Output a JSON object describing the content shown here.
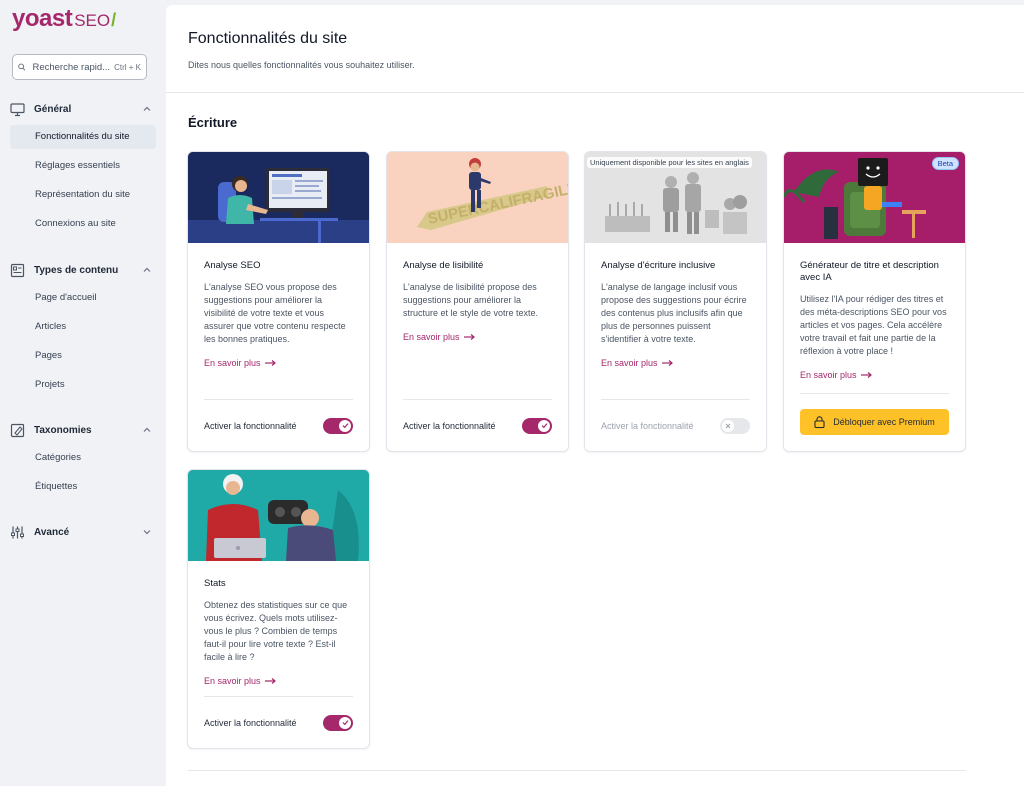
{
  "brand": {
    "name": "yoast",
    "product": "SEO",
    "slash": "/"
  },
  "search": {
    "placeholder": "Recherche rapid...",
    "shortcut": "Ctrl + K"
  },
  "sidebar": {
    "groups": [
      {
        "label": "Général",
        "items": [
          "Fonctionnalités du site",
          "Réglages essentiels",
          "Représentation du site",
          "Connexions au site"
        ]
      },
      {
        "label": "Types de contenu",
        "items": [
          "Page d'accueil",
          "Articles",
          "Pages",
          "Projets"
        ]
      },
      {
        "label": "Taxonomies",
        "items": [
          "Catégories",
          "Étiquettes"
        ]
      },
      {
        "label": "Avancé",
        "items": []
      }
    ]
  },
  "page": {
    "title": "Fonctionnalités du site",
    "description": "Dites nous quelles fonctionnalités vous souhaitez utiliser."
  },
  "section": {
    "title": "Écriture"
  },
  "cards": [
    {
      "title": "Analyse SEO",
      "desc": "L'analyse SEO vous propose des suggestions pour améliorer la visibilité de votre texte et vous assurer que votre contenu respecte les bonnes pratiques.",
      "more": "En savoir plus",
      "toggle_label": "Activer la fonctionnalité",
      "enabled": true
    },
    {
      "title": "Analyse de lisibilité",
      "desc": "L'analyse de lisibilité propose des suggestions pour améliorer la structure et le style de votre texte.",
      "more": "En savoir plus",
      "toggle_label": "Activer la fonctionnalité",
      "enabled": true,
      "thumb_text": "SUPERCALIFRAGILISTIC"
    },
    {
      "title": "Analyse d'écriture inclusive",
      "desc": "L'analyse de langage inclusif vous propose des suggestions pour écrire des contenus plus inclusifs afin que plus de personnes puissent s'identifier à votre texte.",
      "more": "En savoir plus",
      "toggle_label": "Activer la fonctionnalité",
      "enabled": false,
      "badge": "Uniquement disponible pour les sites en anglais"
    },
    {
      "title": "Générateur de titre et description avec IA",
      "desc": "Utilisez l'IA pour rédiger des titres et des méta-descriptions SEO pour vos articles et vos pages. Cela accélère votre travail et fait une partie de la réflexion à votre place !",
      "more": "En savoir plus",
      "badge": "Beta",
      "button": "Débloquer avec Premium"
    },
    {
      "title": "Stats",
      "desc": "Obtenez des statistiques sur ce que vous écrivez. Quels mots utilisez-vous le plus ? Combien de temps faut-il pour lire votre texte ? Est-il facile à lire ?",
      "more": "En savoir plus",
      "toggle_label": "Activer la fonctionnalité",
      "enabled": true
    }
  ],
  "colors": {
    "brand": "#a4286a",
    "premium": "#fec228",
    "accent_green": "#77b227"
  }
}
